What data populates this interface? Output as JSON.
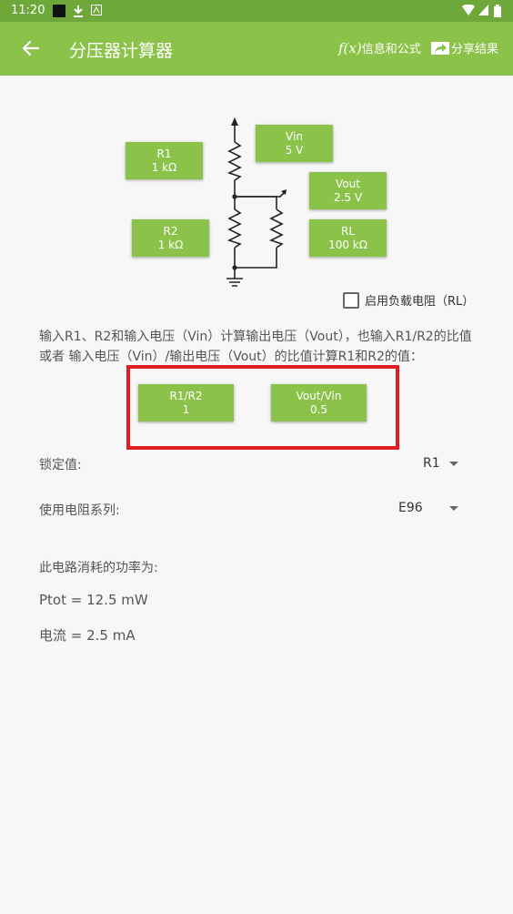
{
  "status_bar": {
    "time": "11:20"
  },
  "app_bar": {
    "title": "分压器计算器",
    "info_fx": "f(x)",
    "info_label": "信息和公式",
    "share_label": "分享结果"
  },
  "circuit": {
    "r1": {
      "name": "R1",
      "value": "1 kΩ"
    },
    "r2": {
      "name": "R2",
      "value": "1 kΩ"
    },
    "vin": {
      "name": "Vin",
      "value": "5 V"
    },
    "vout": {
      "name": "Vout",
      "value": "2.5 V"
    },
    "rl": {
      "name": "RL",
      "value": "100 kΩ"
    }
  },
  "load_checkbox": {
    "label": "启用负载电阻（RL）",
    "checked": false
  },
  "description": "输入R1、R2和输入电压（Vin）计算输出电压（Vout），也输入R1/R2的比值 或者 输入电压（Vin）/输出电压（Vout）的比值计算R1和R2的值：",
  "ratios": {
    "r1_r2": {
      "name": "R1/R2",
      "value": "1"
    },
    "vout_vin": {
      "name": "Vout/Vin",
      "value": "0.5"
    }
  },
  "lock": {
    "label": "锁定值:",
    "value": "R1"
  },
  "series": {
    "label": "使用电阻系列:",
    "value": "E96"
  },
  "power": {
    "heading": "此电路消耗的功率为:",
    "ptot": "Ptot = 12.5 mW",
    "current": "电流 = 2.5 mA"
  },
  "colors": {
    "accent": "#8bc34a",
    "status_bar": "#6fa83a",
    "highlight": "#e01c24"
  }
}
